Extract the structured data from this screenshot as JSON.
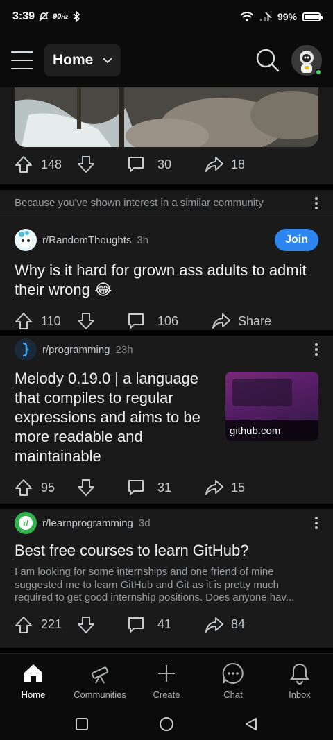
{
  "status_bar": {
    "time": "3:39",
    "refresh_rate": "90",
    "refresh_unit": "Hz",
    "battery": "99%",
    "battery_level": 0.99
  },
  "header": {
    "feed_label": "Home"
  },
  "posts": [
    {
      "kind": "image-tail",
      "upvotes": "148",
      "comments": "30",
      "shares": "18"
    },
    {
      "reason": "Because you've shown interest in a similar community",
      "subreddit": "r/RandomThoughts",
      "age": "3h",
      "join_label": "Join",
      "title": "Why is it hard for grown ass adults to admit their wrong 😂",
      "upvotes": "110",
      "comments": "106",
      "share_label": "Share"
    },
    {
      "subreddit": "r/programming",
      "age": "23h",
      "title": "Melody 0.19.0 | a language that compiles to regular expressions and aims to be more readable and maintainable",
      "link_domain": "github.com",
      "upvotes": "95",
      "comments": "31",
      "shares": "15"
    },
    {
      "subreddit": "r/learnprogramming",
      "age": "3d",
      "title": "Best free courses to learn GitHub?",
      "body": "I am looking for some internships and one friend of mine suggested me to learn GitHub and Git as it is pretty much required to get good internship positions. Does anyone hav...",
      "upvotes": "221",
      "comments": "41",
      "shares": "84"
    }
  ],
  "bottom_nav": [
    {
      "label": "Home",
      "icon": "home-icon",
      "active": true
    },
    {
      "label": "Communities",
      "icon": "telescope-icon"
    },
    {
      "label": "Create",
      "icon": "plus-icon"
    },
    {
      "label": "Chat",
      "icon": "chat-icon"
    },
    {
      "label": "Inbox",
      "icon": "bell-icon"
    }
  ],
  "colors": {
    "background": "#000000",
    "card": "#1a1a1b",
    "join": "#2d85f0",
    "online": "#46d160"
  }
}
